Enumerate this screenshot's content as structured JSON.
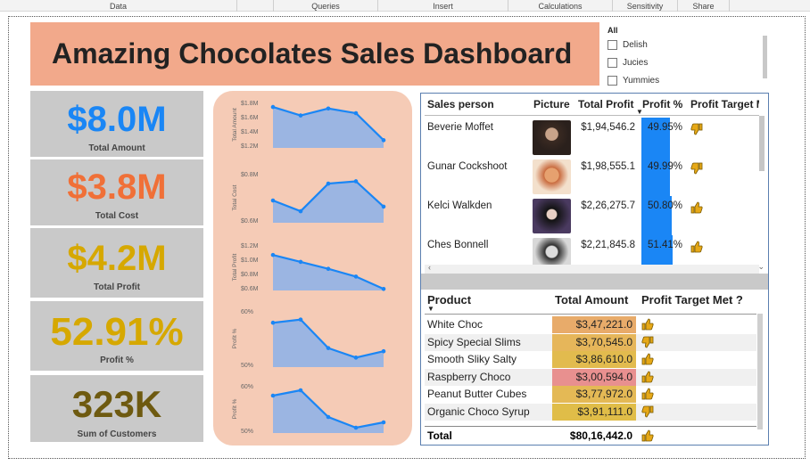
{
  "ribbon": {
    "tabs": [
      "Data",
      "Queries",
      "Insert",
      "Calculations",
      "Sensitivity",
      "Share"
    ]
  },
  "title": "Amazing Chocolates Sales Dashboard",
  "slicer": {
    "header": "All",
    "items": [
      "Delish",
      "Jucies",
      "Yummies"
    ]
  },
  "kpis": [
    {
      "value": "$8.0M",
      "label": "Total Amount",
      "color": "#1a86f5"
    },
    {
      "value": "$3.8M",
      "label": "Total Cost",
      "color": "#f07038"
    },
    {
      "value": "$4.2M",
      "label": "Total Profit",
      "color": "#d6a800"
    },
    {
      "value": "52.91%",
      "label": "Profit %",
      "color": "#d6a800"
    },
    {
      "value": "323K",
      "label": "Sum of Customers",
      "color": "#6e5a10"
    }
  ],
  "chart_data": [
    {
      "type": "area",
      "ylabel": "Total Amount",
      "yticks": [
        "$1.8M",
        "$1.6M",
        "$1.4M",
        "$1.2M"
      ],
      "ylim": [
        1.2,
        1.8
      ],
      "values": [
        1.73,
        1.62,
        1.71,
        1.65,
        1.3
      ]
    },
    {
      "type": "area",
      "ylabel": "Total Cost",
      "yticks": [
        "$0.8M",
        "$0.6M"
      ],
      "ylim": [
        0.55,
        1.2
      ],
      "values": [
        0.84,
        0.7,
        1.06,
        1.09,
        0.76
      ]
    },
    {
      "type": "area",
      "ylabel": "Total Profit",
      "yticks": [
        "$1.2M",
        "$1.0M",
        "$0.8M",
        "$0.6M"
      ],
      "ylim": [
        0.6,
        1.2
      ],
      "values": [
        1.06,
        0.97,
        0.88,
        0.78,
        0.62
      ]
    },
    {
      "type": "area",
      "ylabel": "Profit %",
      "yticks": [
        "60%",
        "50%"
      ],
      "ylim": [
        0.44,
        0.62
      ],
      "values": [
        0.58,
        0.59,
        0.5,
        0.47,
        0.49
      ]
    },
    {
      "type": "area",
      "ylabel": "Profit %",
      "yticks": [
        "60%",
        "50%"
      ],
      "ylim": [
        0.44,
        0.62
      ],
      "values": [
        0.58,
        0.6,
        0.5,
        0.46,
        0.48
      ]
    }
  ],
  "sales_table": {
    "headers": [
      "Sales person",
      "Picture",
      "Total Profit",
      "Profit %",
      "Profit Target M"
    ],
    "rows": [
      {
        "name": "Beverie Moffet",
        "profit": "$1,94,546.2",
        "pct": "49.95%",
        "pct_value": 0.4995,
        "target": "down"
      },
      {
        "name": "Gunar Cockshoot",
        "profit": "$1,98,555.1",
        "pct": "49.99%",
        "pct_value": 0.4999,
        "target": "down"
      },
      {
        "name": "Kelci Walkden",
        "profit": "$2,26,275.7",
        "pct": "50.80%",
        "pct_value": 0.508,
        "target": "up"
      },
      {
        "name": "Ches Bonnell",
        "profit": "$2,21,845.8",
        "pct": "51.41%",
        "pct_value": 0.5141,
        "target": "up"
      }
    ]
  },
  "product_table": {
    "headers": [
      "Product",
      "Total Amount",
      "Profit Target Met ?"
    ],
    "rows": [
      {
        "name": "White Choc",
        "amount": "$3,47,221.0",
        "bg": "#e8ab6a",
        "target": "up"
      },
      {
        "name": "Spicy Special Slims",
        "amount": "$3,70,545.0",
        "bg": "#e6b65a",
        "target": "down"
      },
      {
        "name": "Smooth Sliky Salty",
        "amount": "$3,86,610.0",
        "bg": "#e2bb4e",
        "target": "up"
      },
      {
        "name": "Raspberry Choco",
        "amount": "$3,00,594.0",
        "bg": "#e8908f",
        "target": "up"
      },
      {
        "name": "Peanut Butter Cubes",
        "amount": "$3,77,972.0",
        "bg": "#e4b955",
        "target": "up"
      },
      {
        "name": "Organic Choco Syrup",
        "amount": "$3,91,111.0",
        "bg": "#e0bd48",
        "target": "down"
      }
    ],
    "total_label": "Total",
    "total_amount": "$80,16,442.0",
    "total_target": "up"
  },
  "colors": {
    "thumb": "#e6a817",
    "area_fill": "#9bb5e2",
    "area_line": "#1a86f5"
  }
}
